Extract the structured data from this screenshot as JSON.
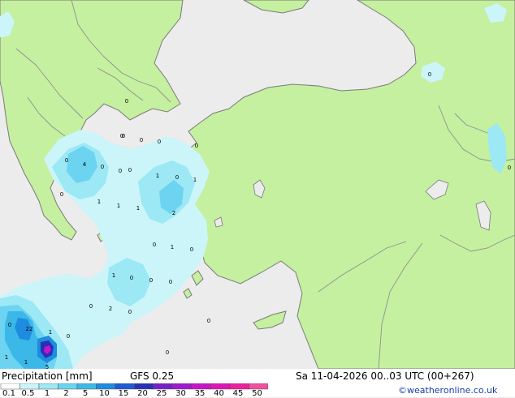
{
  "map": {
    "colors": {
      "sea": "#ececec",
      "land": "#c4f0a0",
      "border": "#909090",
      "coast": "#7a7a7a"
    },
    "value_labels": [
      "0",
      "0",
      "0",
      "0",
      "0",
      "0",
      "0",
      "4",
      "0",
      "0",
      "0",
      "1",
      "0",
      "1",
      "0",
      "1",
      "1",
      "1",
      "2",
      "0",
      "1",
      "0",
      "1",
      "0",
      "0",
      "0",
      "0",
      "2",
      "0",
      "0",
      "0",
      "22",
      "1",
      "0",
      "1",
      "1",
      "5",
      "0",
      "0",
      "0"
    ]
  },
  "footer": {
    "title": "Precipitation [mm]",
    "model": "GFS 0.25",
    "datetime": "Sa 11-04-2026 00..03 UTC (00+267)",
    "credit": "©weatheronline.co.uk",
    "legend": {
      "ticks": [
        "0.1",
        "0.5",
        "1",
        "2",
        "5",
        "10",
        "15",
        "20",
        "25",
        "30",
        "35",
        "40",
        "45",
        "50"
      ],
      "colors": [
        "#ffffff",
        "#ccf5fa",
        "#9ce8f5",
        "#6cd4f0",
        "#3cb8e8",
        "#1e8ce0",
        "#1e5ad2",
        "#2830b4",
        "#7820c8",
        "#a018d0",
        "#c814c8",
        "#e014b4",
        "#f01ea0",
        "#f050a0"
      ]
    }
  }
}
